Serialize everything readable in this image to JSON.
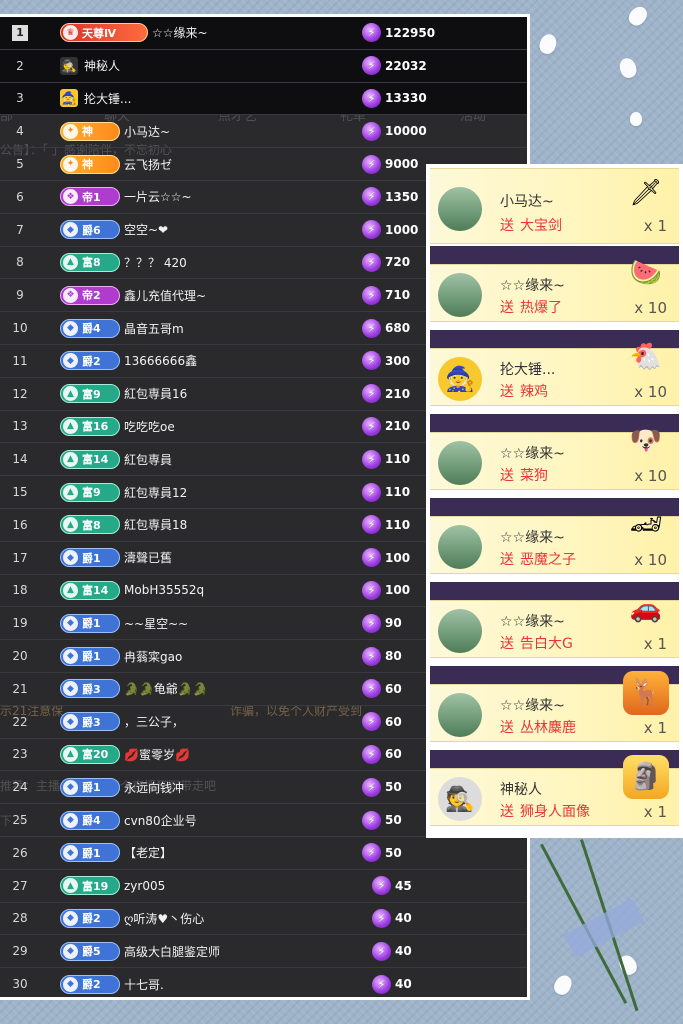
{
  "rankings": [
    {
      "rank": "1",
      "badge": {
        "type": "red",
        "icon": "crown-icon",
        "label": "天尊Ⅳ"
      },
      "name": "☆☆缘来~",
      "value": "122950"
    },
    {
      "rank": "2",
      "badge": null,
      "avatar": "mystery-person-icon",
      "name": "神秘人",
      "value": "22032"
    },
    {
      "rank": "3",
      "badge": null,
      "avatar": "witch-hat-icon",
      "name": "抡大锤...",
      "value": "13330"
    },
    {
      "rank": "4",
      "badge": {
        "type": "orange",
        "icon": "wing-icon",
        "label": "神"
      },
      "name": "小马达~",
      "value": "10000"
    },
    {
      "rank": "5",
      "badge": {
        "type": "orange",
        "icon": "wing-icon",
        "label": "神"
      },
      "name": "云飞扬ゼ",
      "value": "9000"
    },
    {
      "rank": "6",
      "badge": {
        "type": "purple",
        "icon": "emperor-icon",
        "label": "帝1"
      },
      "name": "一片云☆☆~",
      "value": "1350"
    },
    {
      "rank": "7",
      "badge": {
        "type": "blue",
        "icon": "diamond-icon",
        "label": "爵6"
      },
      "name": "空空~❤",
      "value": "1000"
    },
    {
      "rank": "8",
      "badge": {
        "type": "green",
        "icon": "triangle-icon",
        "label": "富8"
      },
      "name": "？？？ 420",
      "value": "720"
    },
    {
      "rank": "9",
      "badge": {
        "type": "purple",
        "icon": "emperor-icon",
        "label": "帝2"
      },
      "name": "鑫儿充值代理~",
      "value": "710"
    },
    {
      "rank": "10",
      "badge": {
        "type": "blue",
        "icon": "diamond-icon",
        "label": "爵4"
      },
      "name": "晶音五哥m",
      "value": "680"
    },
    {
      "rank": "11",
      "badge": {
        "type": "blue",
        "icon": "diamond-icon",
        "label": "爵2"
      },
      "name": "13666666鑫",
      "value": "300"
    },
    {
      "rank": "12",
      "badge": {
        "type": "green",
        "icon": "triangle-icon",
        "label": "富9"
      },
      "name": "紅包専員16",
      "value": "210"
    },
    {
      "rank": "13",
      "badge": {
        "type": "green",
        "icon": "triangle-icon",
        "label": "富16"
      },
      "name": "吃吃吃oe",
      "value": "210"
    },
    {
      "rank": "14",
      "badge": {
        "type": "green",
        "icon": "triangle-icon",
        "label": "富14"
      },
      "name": "紅包専員",
      "value": "110"
    },
    {
      "rank": "15",
      "badge": {
        "type": "green",
        "icon": "triangle-icon",
        "label": "富9"
      },
      "name": "紅包専員12",
      "value": "110"
    },
    {
      "rank": "16",
      "badge": {
        "type": "green",
        "icon": "triangle-icon",
        "label": "富8"
      },
      "name": "紅包専員18",
      "value": "110"
    },
    {
      "rank": "17",
      "badge": {
        "type": "blue",
        "icon": "diamond-icon",
        "label": "爵1"
      },
      "name": "濤聲已舊",
      "value": "100"
    },
    {
      "rank": "18",
      "badge": {
        "type": "green",
        "icon": "triangle-icon",
        "label": "富14"
      },
      "name": "MobH35552q",
      "value": "100"
    },
    {
      "rank": "19",
      "badge": {
        "type": "blue",
        "icon": "diamond-icon",
        "label": "爵1"
      },
      "name": "~~星空~~",
      "value": "90"
    },
    {
      "rank": "20",
      "badge": {
        "type": "blue",
        "icon": "diamond-icon",
        "label": "爵1"
      },
      "name": "冉蓊寀gao",
      "value": "80"
    },
    {
      "rank": "21",
      "badge": {
        "type": "blue",
        "icon": "diamond-icon",
        "label": "爵3"
      },
      "name": "🐊🐊龟爺🐊🐊",
      "value": "60"
    },
    {
      "rank": "22",
      "badge": {
        "type": "blue",
        "icon": "diamond-icon",
        "label": "爵3"
      },
      "name": "，三公子，",
      "value": "60"
    },
    {
      "rank": "23",
      "badge": {
        "type": "green",
        "icon": "triangle-icon",
        "label": "富20"
      },
      "name": "💋蜜零岁💋",
      "value": "60"
    },
    {
      "rank": "24",
      "badge": {
        "type": "blue",
        "icon": "diamond-icon",
        "label": "爵1"
      },
      "name": "永远向钱冲",
      "value": "50"
    },
    {
      "rank": "25",
      "badge": {
        "type": "blue",
        "icon": "diamond-icon",
        "label": "爵4"
      },
      "name": "cvn80企业号",
      "value": "50"
    },
    {
      "rank": "26",
      "badge": {
        "type": "blue",
        "icon": "diamond-icon",
        "label": "爵1"
      },
      "name": "【老定】",
      "value": "50"
    },
    {
      "rank": "27",
      "badge": {
        "type": "green",
        "icon": "triangle-icon",
        "label": "富19"
      },
      "name": "zyr005",
      "value": "45"
    },
    {
      "rank": "28",
      "badge": {
        "type": "blue",
        "icon": "diamond-icon",
        "label": "爵2"
      },
      "name": "ღ听涛♥丶伤心",
      "value": "40"
    },
    {
      "rank": "29",
      "badge": {
        "type": "blue",
        "icon": "diamond-icon",
        "label": "爵5"
      },
      "name": "高级大白腿鉴定师",
      "value": "40"
    },
    {
      "rank": "30",
      "badge": {
        "type": "blue",
        "icon": "diamond-icon",
        "label": "爵2"
      },
      "name": "十七哥.",
      "value": "40"
    }
  ],
  "background_overlay": {
    "tabs": [
      "部",
      "聊天",
      "点才艺",
      "礼单",
      "活动"
    ],
    "notice": "公告】：「   」感谢陪伴，不忘初心",
    "warning": "示21注意保",
    "warning_tail": "诈骗，以免个人财产受到",
    "recommend": "推荐：主播发起单，整个直播狂观带走吧",
    "misc_left": "下 ×"
  },
  "gifts": [
    {
      "sender": "小马达~",
      "action": "送",
      "gift": "大宝剑",
      "count": "x 1",
      "avatar": "landscape-avatar",
      "gift_icon": "sword-gift-icon"
    },
    {
      "sender": "☆☆缘来~",
      "action": "送",
      "gift": "热爆了",
      "count": "x 10",
      "avatar": "landscape-avatar",
      "gift_icon": "melon-gift-icon"
    },
    {
      "sender": "抡大锤...",
      "action": "送",
      "gift": "辣鸡",
      "count": "x 10",
      "avatar": "witch-hat-avatar",
      "gift_icon": "chicken-gift-icon"
    },
    {
      "sender": "☆☆缘来~",
      "action": "送",
      "gift": "菜狗",
      "count": "x 10",
      "avatar": "landscape-avatar",
      "gift_icon": "dog-gift-icon"
    },
    {
      "sender": "☆☆缘来~",
      "action": "送",
      "gift": "恶魔之子",
      "count": "x 10",
      "avatar": "landscape-avatar",
      "gift_icon": "car-gift-icon"
    },
    {
      "sender": "☆☆缘来~",
      "action": "送",
      "gift": "告白大G",
      "count": "x 1",
      "avatar": "landscape-avatar",
      "gift_icon": "pink-car-gift-icon"
    },
    {
      "sender": "☆☆缘来~",
      "action": "送",
      "gift": "丛林麋鹿",
      "count": "x 1",
      "avatar": "landscape-avatar",
      "gift_icon": "deer-gift-icon"
    },
    {
      "sender": "神秘人",
      "action": "送",
      "gift": "狮身人面像",
      "count": "x 1",
      "avatar": "mystery-person-avatar",
      "gift_icon": "sphinx-gift-icon"
    }
  ],
  "colors": {
    "panel_bg": "#2a2a2d",
    "badge_blue": "#3f74d6",
    "badge_green": "#25a989",
    "badge_purple": "#b03ccf",
    "badge_orange": "#ff8a1a",
    "gift_text": "#e8363a",
    "gift_card": "#fff6bf"
  }
}
